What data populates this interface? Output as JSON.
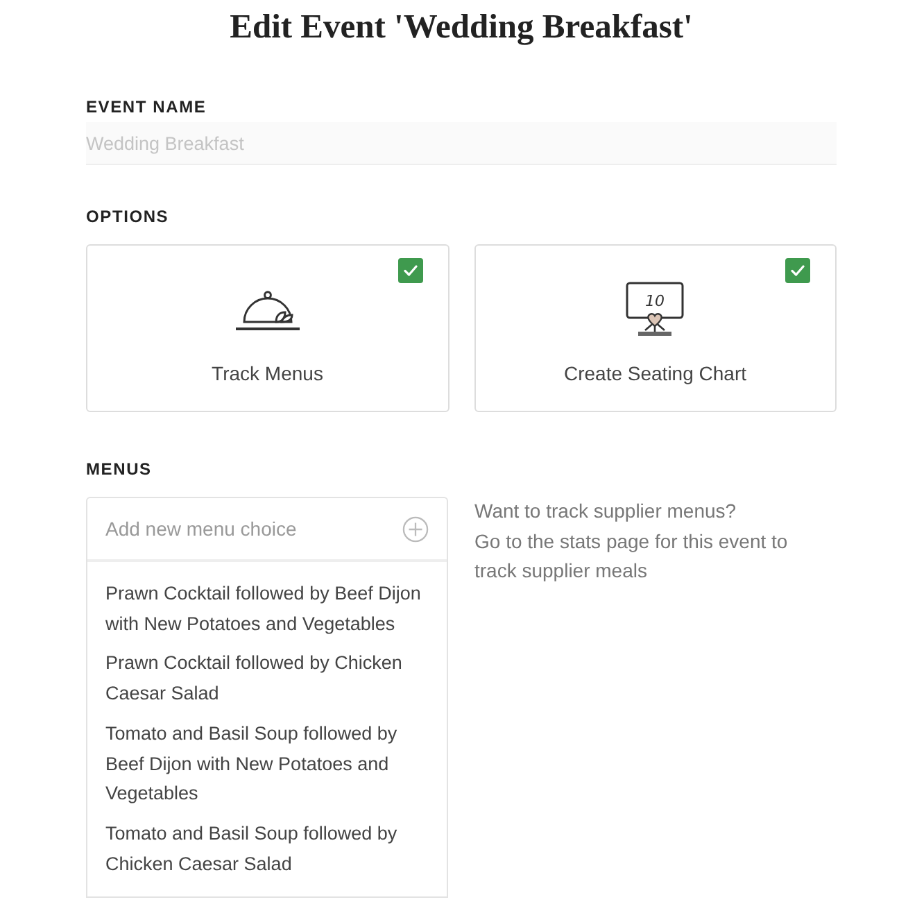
{
  "title": "Edit Event 'Wedding Breakfast'",
  "event_name": {
    "label": "EVENT NAME",
    "placeholder": "Wedding Breakfast"
  },
  "options": {
    "label": "OPTIONS",
    "items": [
      {
        "kind": "cloche",
        "label": "Track Menus",
        "checked": true
      },
      {
        "kind": "seating",
        "label": "Create Seating Chart",
        "checked": true,
        "sign_text": "10"
      }
    ]
  },
  "menus": {
    "label": "MENUS",
    "add_field": {
      "placeholder": "Add new menu choice"
    },
    "items": [
      "Prawn Cocktail followed by Beef Dijon with New Potatoes and Vegetables",
      "Prawn Cocktail followed by Chicken Caesar Salad",
      "Tomato and Basil Soup followed by Beef Dijon with New Potatoes and Vegetables",
      "Tomato and Basil Soup followed by Chicken Caesar Salad"
    ],
    "note": [
      "Want to track supplier menus?",
      "Go to the stats page for this event to track supplier meals"
    ]
  }
}
